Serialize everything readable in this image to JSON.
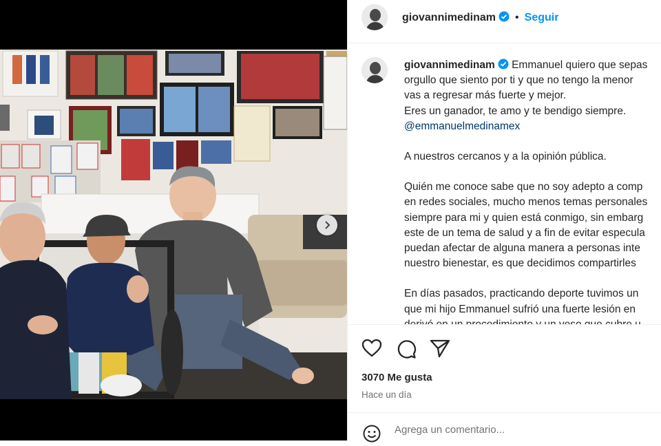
{
  "post": {
    "username": "giovannimedinam",
    "follow_label": "Seguir",
    "separator": "•",
    "verified": true
  },
  "caption": {
    "username": "giovannimedinam",
    "lines": [
      "Emmanuel quiero que sepas",
      "orgullo que siento por ti y que no tengo la menor",
      "vas a regresar más fuerte y mejor.",
      "Eres un ganador, te amo y te bendigo siempre.",
      "@emmanuelmedinamex",
      "",
      "A nuestros cercanos y a la opinión pública.",
      "",
      "Quién me conoce sabe que no soy adepto a comp",
      "en redes sociales, mucho menos temas personales",
      "siempre para mi y quien está conmigo, sin embarg",
      "este de un tema de salud y a fin de evitar especula",
      "puedan afectar de alguna manera a personas inte",
      "nuestro bienestar, es que decidimos compartirles",
      "",
      "En días pasados, practicando deporte tuvimos un",
      "que mi hijo Emmanuel sufrió una fuerte lesión en",
      "derivó en un procedimiento y un yeso que cubre u"
    ]
  },
  "actions": {
    "like_icon": "heart-icon",
    "comment_icon": "comment-icon",
    "share_icon": "share-icon"
  },
  "stats": {
    "likes": "3070 Me gusta",
    "time": "Hace un día"
  },
  "comment": {
    "emoji_icon": "emoji-icon",
    "placeholder": "Agrega un comentario..."
  },
  "colors": {
    "accent": "#0095f6",
    "verified": "#0095f6",
    "mention": "#00376b",
    "muted": "#737373",
    "text": "#262626"
  }
}
